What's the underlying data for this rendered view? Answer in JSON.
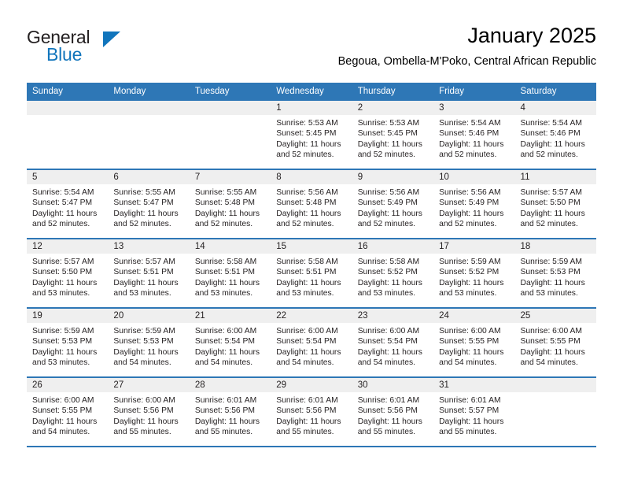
{
  "brand": {
    "name_part1": "General",
    "name_part2": "Blue",
    "accent_color": "#1175bc"
  },
  "header": {
    "title": "January 2025",
    "subtitle": "Begoua, Ombella-M'Poko, Central African Republic"
  },
  "theme": {
    "header_blue": "#2e77b6",
    "daynum_band": "#efefef",
    "text": "#231f20"
  },
  "weekday_headers": [
    "Sunday",
    "Monday",
    "Tuesday",
    "Wednesday",
    "Thursday",
    "Friday",
    "Saturday"
  ],
  "weeks": [
    [
      {
        "day": "",
        "sunrise": "",
        "sunset": "",
        "daylight_line1": "",
        "daylight_line2": ""
      },
      {
        "day": "",
        "sunrise": "",
        "sunset": "",
        "daylight_line1": "",
        "daylight_line2": ""
      },
      {
        "day": "",
        "sunrise": "",
        "sunset": "",
        "daylight_line1": "",
        "daylight_line2": ""
      },
      {
        "day": "1",
        "sunrise": "Sunrise: 5:53 AM",
        "sunset": "Sunset: 5:45 PM",
        "daylight_line1": "Daylight: 11 hours",
        "daylight_line2": "and 52 minutes."
      },
      {
        "day": "2",
        "sunrise": "Sunrise: 5:53 AM",
        "sunset": "Sunset: 5:45 PM",
        "daylight_line1": "Daylight: 11 hours",
        "daylight_line2": "and 52 minutes."
      },
      {
        "day": "3",
        "sunrise": "Sunrise: 5:54 AM",
        "sunset": "Sunset: 5:46 PM",
        "daylight_line1": "Daylight: 11 hours",
        "daylight_line2": "and 52 minutes."
      },
      {
        "day": "4",
        "sunrise": "Sunrise: 5:54 AM",
        "sunset": "Sunset: 5:46 PM",
        "daylight_line1": "Daylight: 11 hours",
        "daylight_line2": "and 52 minutes."
      }
    ],
    [
      {
        "day": "5",
        "sunrise": "Sunrise: 5:54 AM",
        "sunset": "Sunset: 5:47 PM",
        "daylight_line1": "Daylight: 11 hours",
        "daylight_line2": "and 52 minutes."
      },
      {
        "day": "6",
        "sunrise": "Sunrise: 5:55 AM",
        "sunset": "Sunset: 5:47 PM",
        "daylight_line1": "Daylight: 11 hours",
        "daylight_line2": "and 52 minutes."
      },
      {
        "day": "7",
        "sunrise": "Sunrise: 5:55 AM",
        "sunset": "Sunset: 5:48 PM",
        "daylight_line1": "Daylight: 11 hours",
        "daylight_line2": "and 52 minutes."
      },
      {
        "day": "8",
        "sunrise": "Sunrise: 5:56 AM",
        "sunset": "Sunset: 5:48 PM",
        "daylight_line1": "Daylight: 11 hours",
        "daylight_line2": "and 52 minutes."
      },
      {
        "day": "9",
        "sunrise": "Sunrise: 5:56 AM",
        "sunset": "Sunset: 5:49 PM",
        "daylight_line1": "Daylight: 11 hours",
        "daylight_line2": "and 52 minutes."
      },
      {
        "day": "10",
        "sunrise": "Sunrise: 5:56 AM",
        "sunset": "Sunset: 5:49 PM",
        "daylight_line1": "Daylight: 11 hours",
        "daylight_line2": "and 52 minutes."
      },
      {
        "day": "11",
        "sunrise": "Sunrise: 5:57 AM",
        "sunset": "Sunset: 5:50 PM",
        "daylight_line1": "Daylight: 11 hours",
        "daylight_line2": "and 52 minutes."
      }
    ],
    [
      {
        "day": "12",
        "sunrise": "Sunrise: 5:57 AM",
        "sunset": "Sunset: 5:50 PM",
        "daylight_line1": "Daylight: 11 hours",
        "daylight_line2": "and 53 minutes."
      },
      {
        "day": "13",
        "sunrise": "Sunrise: 5:57 AM",
        "sunset": "Sunset: 5:51 PM",
        "daylight_line1": "Daylight: 11 hours",
        "daylight_line2": "and 53 minutes."
      },
      {
        "day": "14",
        "sunrise": "Sunrise: 5:58 AM",
        "sunset": "Sunset: 5:51 PM",
        "daylight_line1": "Daylight: 11 hours",
        "daylight_line2": "and 53 minutes."
      },
      {
        "day": "15",
        "sunrise": "Sunrise: 5:58 AM",
        "sunset": "Sunset: 5:51 PM",
        "daylight_line1": "Daylight: 11 hours",
        "daylight_line2": "and 53 minutes."
      },
      {
        "day": "16",
        "sunrise": "Sunrise: 5:58 AM",
        "sunset": "Sunset: 5:52 PM",
        "daylight_line1": "Daylight: 11 hours",
        "daylight_line2": "and 53 minutes."
      },
      {
        "day": "17",
        "sunrise": "Sunrise: 5:59 AM",
        "sunset": "Sunset: 5:52 PM",
        "daylight_line1": "Daylight: 11 hours",
        "daylight_line2": "and 53 minutes."
      },
      {
        "day": "18",
        "sunrise": "Sunrise: 5:59 AM",
        "sunset": "Sunset: 5:53 PM",
        "daylight_line1": "Daylight: 11 hours",
        "daylight_line2": "and 53 minutes."
      }
    ],
    [
      {
        "day": "19",
        "sunrise": "Sunrise: 5:59 AM",
        "sunset": "Sunset: 5:53 PM",
        "daylight_line1": "Daylight: 11 hours",
        "daylight_line2": "and 53 minutes."
      },
      {
        "day": "20",
        "sunrise": "Sunrise: 5:59 AM",
        "sunset": "Sunset: 5:53 PM",
        "daylight_line1": "Daylight: 11 hours",
        "daylight_line2": "and 54 minutes."
      },
      {
        "day": "21",
        "sunrise": "Sunrise: 6:00 AM",
        "sunset": "Sunset: 5:54 PM",
        "daylight_line1": "Daylight: 11 hours",
        "daylight_line2": "and 54 minutes."
      },
      {
        "day": "22",
        "sunrise": "Sunrise: 6:00 AM",
        "sunset": "Sunset: 5:54 PM",
        "daylight_line1": "Daylight: 11 hours",
        "daylight_line2": "and 54 minutes."
      },
      {
        "day": "23",
        "sunrise": "Sunrise: 6:00 AM",
        "sunset": "Sunset: 5:54 PM",
        "daylight_line1": "Daylight: 11 hours",
        "daylight_line2": "and 54 minutes."
      },
      {
        "day": "24",
        "sunrise": "Sunrise: 6:00 AM",
        "sunset": "Sunset: 5:55 PM",
        "daylight_line1": "Daylight: 11 hours",
        "daylight_line2": "and 54 minutes."
      },
      {
        "day": "25",
        "sunrise": "Sunrise: 6:00 AM",
        "sunset": "Sunset: 5:55 PM",
        "daylight_line1": "Daylight: 11 hours",
        "daylight_line2": "and 54 minutes."
      }
    ],
    [
      {
        "day": "26",
        "sunrise": "Sunrise: 6:00 AM",
        "sunset": "Sunset: 5:55 PM",
        "daylight_line1": "Daylight: 11 hours",
        "daylight_line2": "and 54 minutes."
      },
      {
        "day": "27",
        "sunrise": "Sunrise: 6:00 AM",
        "sunset": "Sunset: 5:56 PM",
        "daylight_line1": "Daylight: 11 hours",
        "daylight_line2": "and 55 minutes."
      },
      {
        "day": "28",
        "sunrise": "Sunrise: 6:01 AM",
        "sunset": "Sunset: 5:56 PM",
        "daylight_line1": "Daylight: 11 hours",
        "daylight_line2": "and 55 minutes."
      },
      {
        "day": "29",
        "sunrise": "Sunrise: 6:01 AM",
        "sunset": "Sunset: 5:56 PM",
        "daylight_line1": "Daylight: 11 hours",
        "daylight_line2": "and 55 minutes."
      },
      {
        "day": "30",
        "sunrise": "Sunrise: 6:01 AM",
        "sunset": "Sunset: 5:56 PM",
        "daylight_line1": "Daylight: 11 hours",
        "daylight_line2": "and 55 minutes."
      },
      {
        "day": "31",
        "sunrise": "Sunrise: 6:01 AM",
        "sunset": "Sunset: 5:57 PM",
        "daylight_line1": "Daylight: 11 hours",
        "daylight_line2": "and 55 minutes."
      },
      {
        "day": "",
        "sunrise": "",
        "sunset": "",
        "daylight_line1": "",
        "daylight_line2": ""
      }
    ]
  ]
}
